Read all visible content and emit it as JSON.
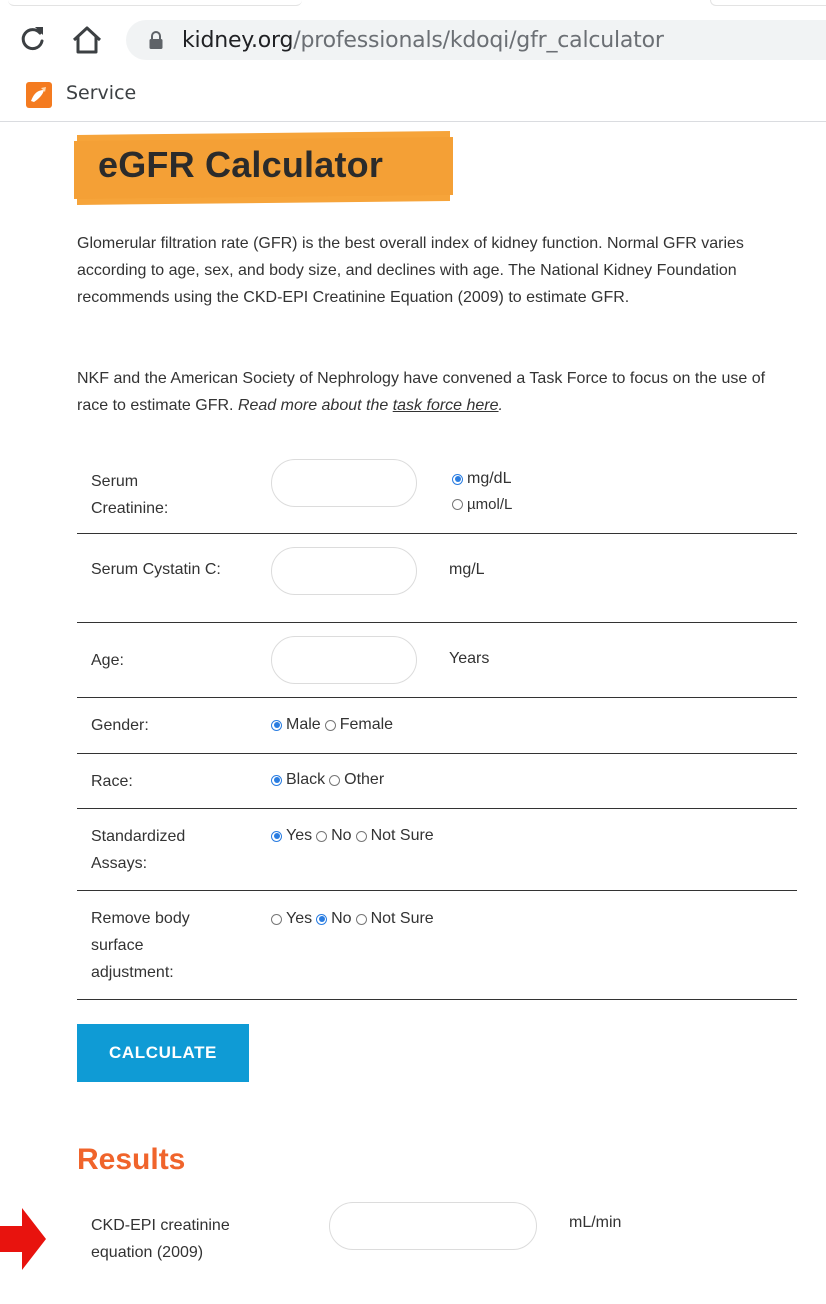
{
  "browser": {
    "url_domain": "kidney.org",
    "url_path": "/professionals/kdoqi/gfr_calculator",
    "bookmark_label": "Service",
    "colors": {
      "bookmark_icon": "#f47b20"
    }
  },
  "page": {
    "title": "eGFR Calculator",
    "intro": "Glomerular filtration rate (GFR) is the best overall index of kidney function. Normal GFR varies according to age, sex, and body size, and declines with age. The National Kidney Foundation recommends using the CKD-EPI Creatinine Equation (2009) to estimate GFR.",
    "task_force_text": "NKF and the American Society of Nephrology have convened a Task Force to focus on the use of race to estimate GFR. ",
    "read_more_prefix": "Read more about the ",
    "read_more_link": "task force here",
    "read_more_suffix": "."
  },
  "form": {
    "serum_creatinine": {
      "label": "Serum Creatinine:",
      "value": "",
      "units": [
        {
          "label": "mg/dL",
          "selected": true
        },
        {
          "label": "µmol/L",
          "selected": false
        }
      ]
    },
    "cystatin": {
      "label": "Serum Cystatin C:",
      "value": "",
      "unit": "mg/L"
    },
    "age": {
      "label": "Age:",
      "value": "",
      "unit": "Years"
    },
    "gender": {
      "label": "Gender:",
      "options": [
        "Male",
        "Female"
      ],
      "selected": "Male"
    },
    "race": {
      "label": "Race:",
      "options": [
        "Black",
        "Other"
      ],
      "selected": "Black"
    },
    "assays": {
      "label": "Standardized Assays:",
      "options": [
        "Yes",
        "No",
        "Not Sure"
      ],
      "selected": "Yes"
    },
    "bsa": {
      "label": "Remove body surface adjustment:",
      "options": [
        "Yes",
        "No",
        "Not Sure"
      ],
      "selected": "No"
    },
    "calculate_label": "CALCULATE"
  },
  "results": {
    "title": "Results",
    "ckd_epi_label": "CKD-EPI creatinine equation (2009)",
    "ckd_epi_value": "",
    "ckd_epi_unit": "mL/min"
  },
  "colors": {
    "accent_orange": "#f6a43a",
    "results_title": "#f0642b",
    "button": "#0f9bd5",
    "arrow": "#e8130e"
  }
}
